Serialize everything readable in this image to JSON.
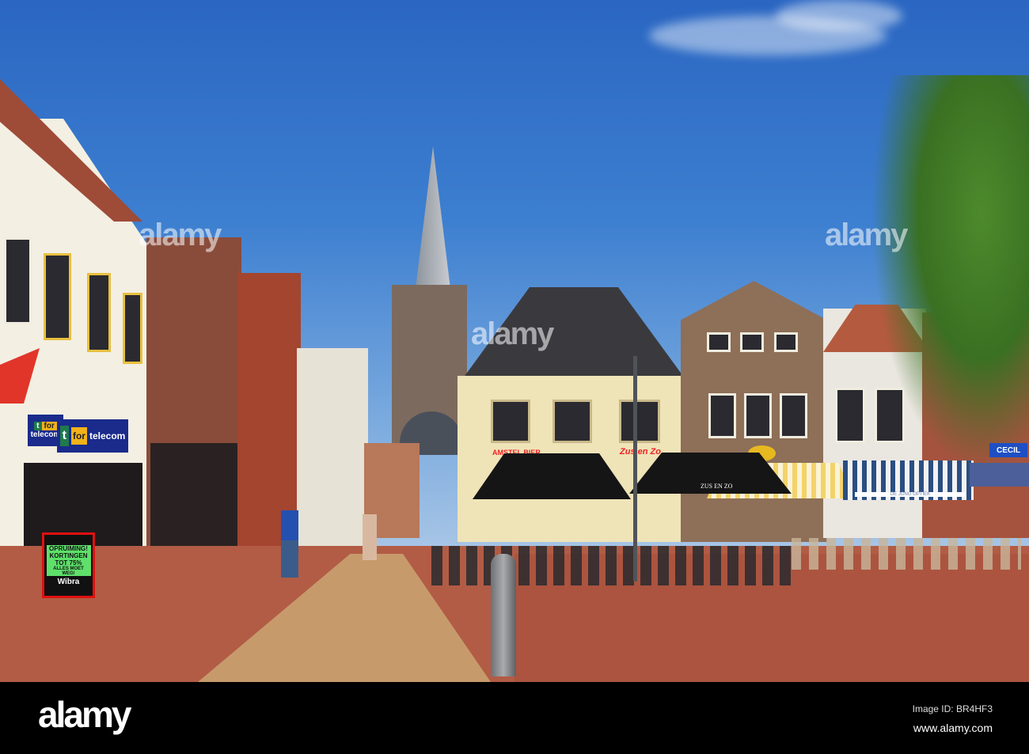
{
  "signs": {
    "telecom_small": {
      "t": "t",
      "for": "for",
      "name": "telecom"
    },
    "telecom_large": {
      "t": "t",
      "for": "for",
      "name": "telecom"
    },
    "sale_board": {
      "line1": "OPRUIMING!",
      "line2": "KORTINGEN",
      "line3": "TOT 75%",
      "line4": "ALLES MOET WEG!",
      "brand": "Wibra"
    },
    "amstel": "AMSTEL BIER",
    "zus_en_zo_facade": "Zus en Zo",
    "umbrella": "ZUS EN ZO",
    "optiek": "DE JONG OPTIEK",
    "cecil": "CECIL"
  },
  "watermark": {
    "text": "alamy"
  },
  "footer": {
    "logo": "alamy",
    "image_id": "Image ID: BR4HF3",
    "url": "www.alamy.com"
  },
  "colors": {
    "sky": "#3d7fd0",
    "pavement": "#b25c45",
    "footer": "#000000"
  }
}
